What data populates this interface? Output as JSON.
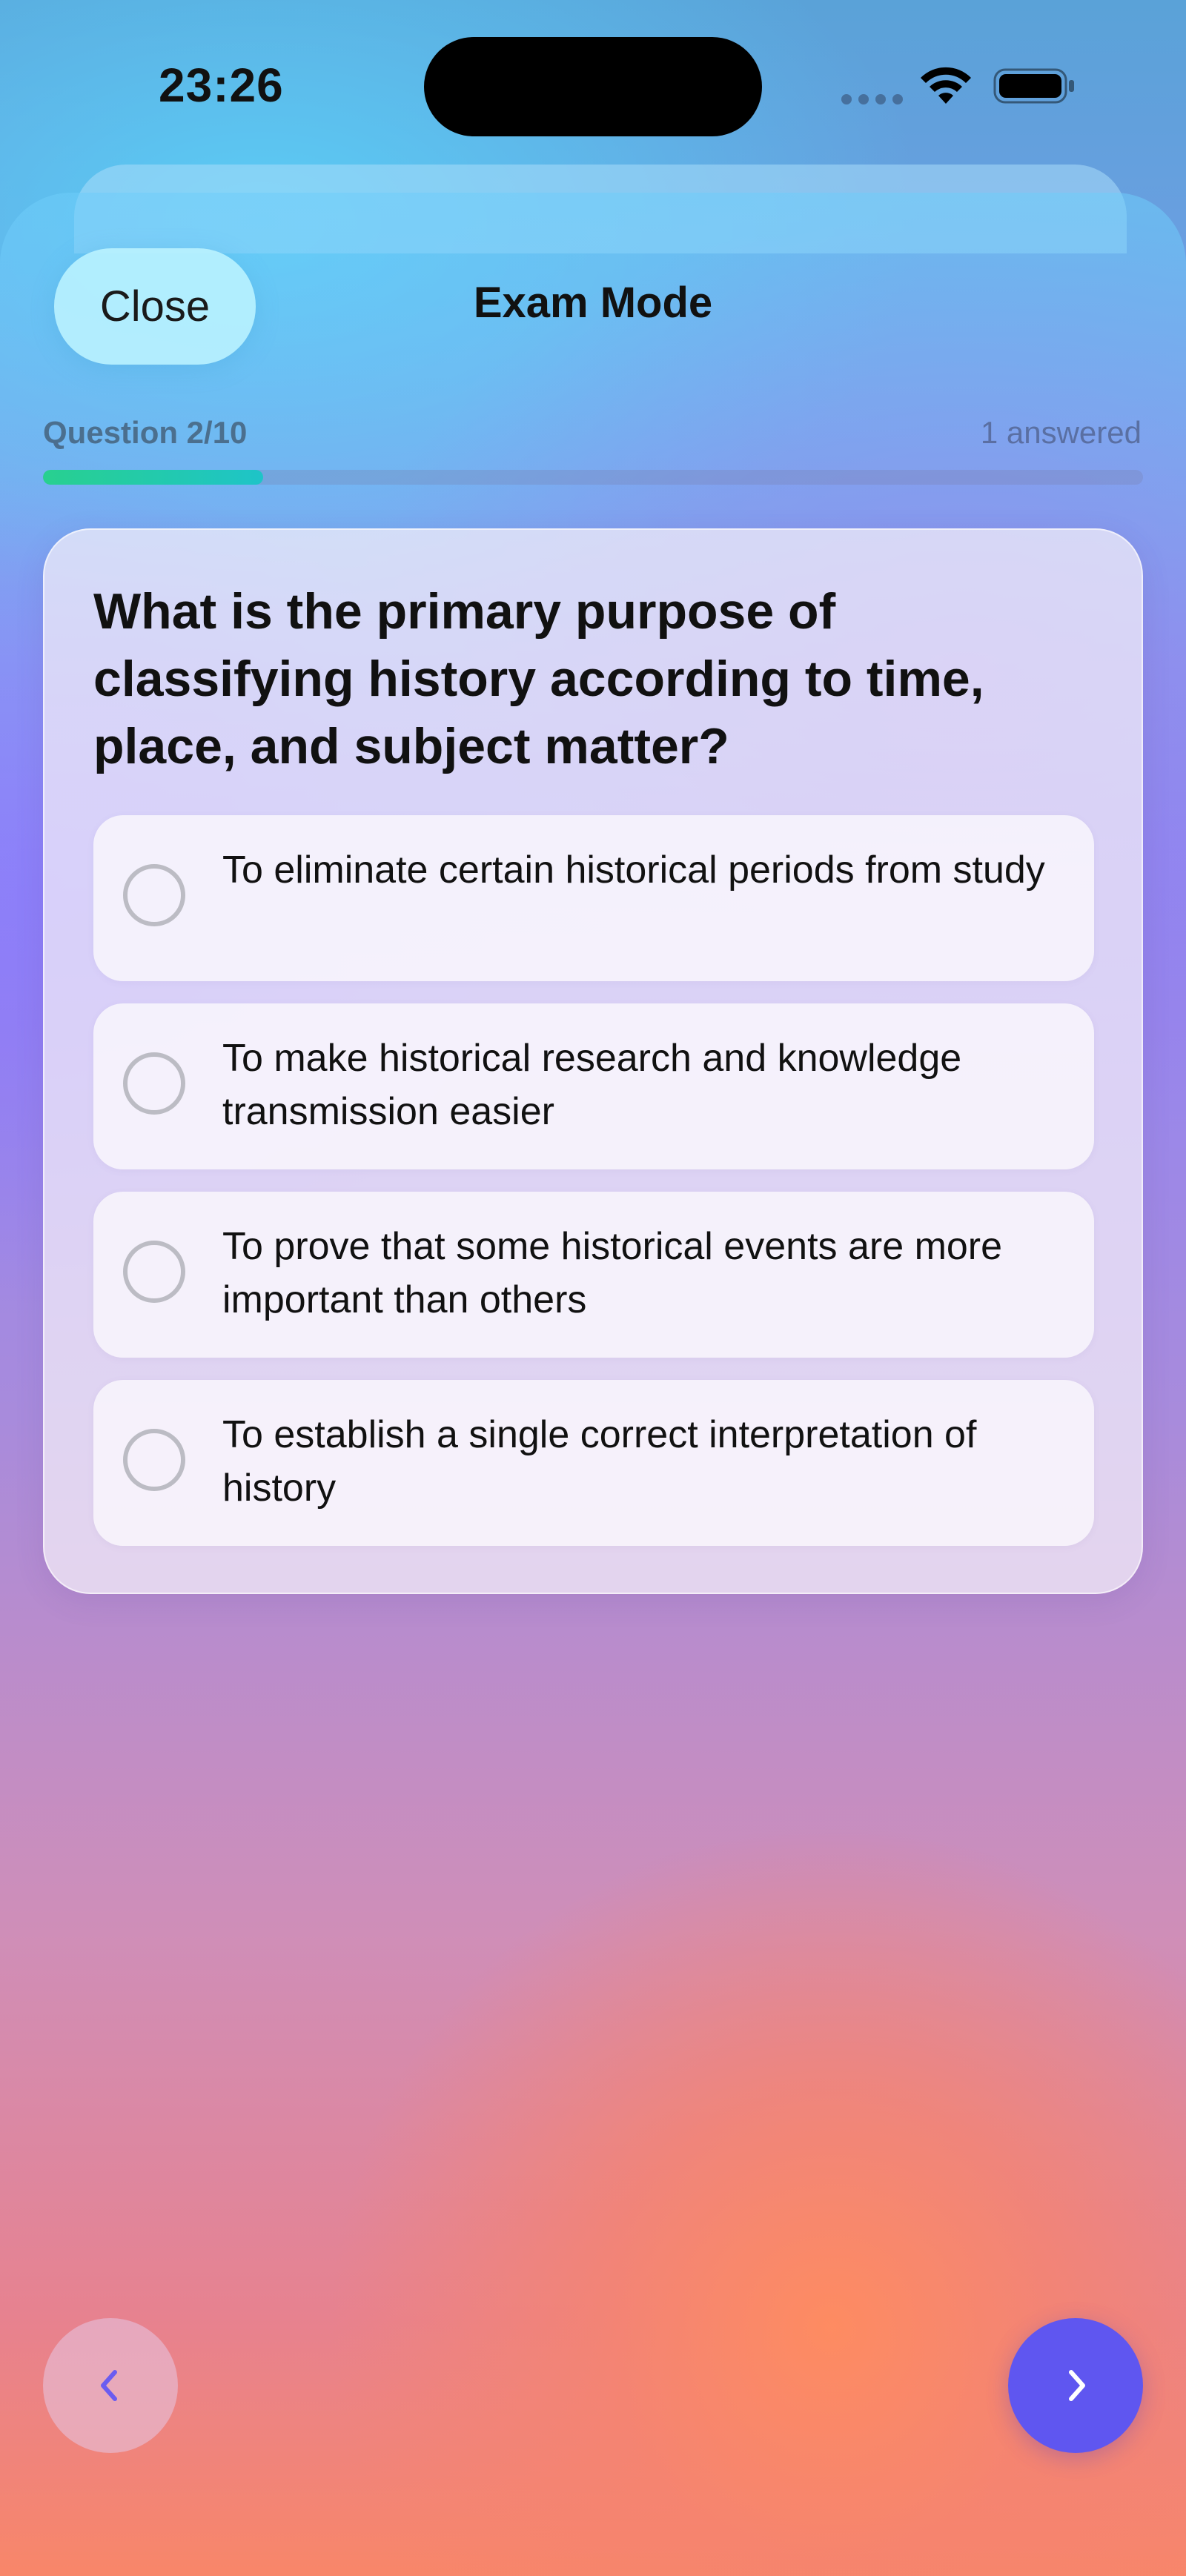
{
  "status_bar": {
    "time": "23:26"
  },
  "header": {
    "close_label": "Close",
    "title": "Exam Mode"
  },
  "progress": {
    "label": "Question 2/10",
    "answered": "1 answered",
    "fraction": 0.2,
    "fill_color": "#28d08f"
  },
  "question": {
    "text": "What is the primary purpose of classifying history according to time, place, and subject matter?",
    "options": [
      {
        "label": "To eliminate certain historical periods from study",
        "selected": false
      },
      {
        "label": "To make historical research and knowledge transmission easier",
        "selected": false
      },
      {
        "label": "To prove that some historical events are more important than others",
        "selected": false
      },
      {
        "label": "To establish a single correct interpretation of history",
        "selected": false
      }
    ]
  },
  "navigation": {
    "prev_icon": "chevron-left-icon",
    "next_icon": "chevron-right-icon",
    "accent_color": "#5f56f0"
  }
}
